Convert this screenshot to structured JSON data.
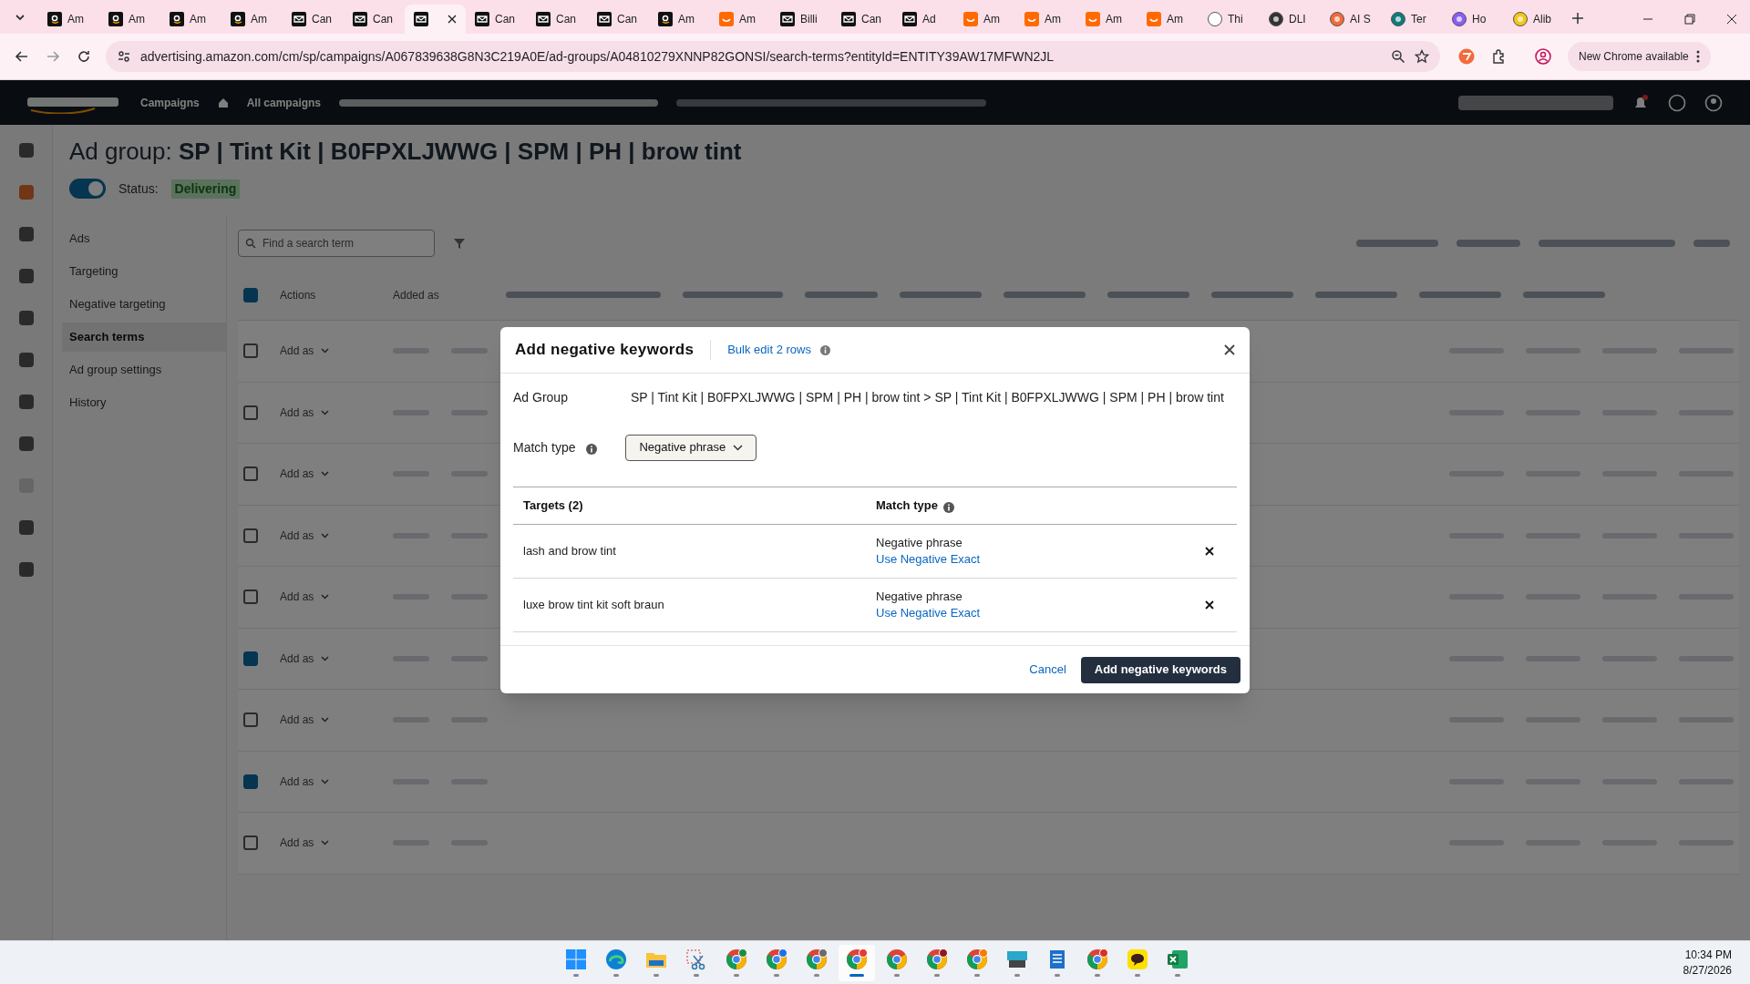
{
  "browser": {
    "tabs": [
      {
        "title": "Am",
        "kind": "amazon",
        "selected": false
      },
      {
        "title": "Am",
        "kind": "amazon",
        "selected": false
      },
      {
        "title": "Am",
        "kind": "amazon",
        "selected": false
      },
      {
        "title": "Am",
        "kind": "amazon",
        "selected": false
      },
      {
        "title": "Can",
        "kind": "mail",
        "selected": false
      },
      {
        "title": "Can",
        "kind": "mail",
        "selected": false
      },
      {
        "kind": "mail",
        "selected": true
      },
      {
        "title": "Can",
        "kind": "mail",
        "selected": false
      },
      {
        "title": "Can",
        "kind": "mail",
        "selected": false
      },
      {
        "title": "Can",
        "kind": "mail",
        "selected": false
      },
      {
        "title": "Am",
        "kind": "amazon",
        "selected": false
      },
      {
        "title": "Am",
        "kind": "orange",
        "selected": false
      },
      {
        "title": "Billi",
        "kind": "mail",
        "selected": false
      },
      {
        "title": "Can",
        "kind": "mail",
        "selected": false
      },
      {
        "title": "Ad",
        "kind": "mail",
        "selected": false
      },
      {
        "title": "Am",
        "kind": "orange",
        "selected": false
      },
      {
        "title": "Am",
        "kind": "orange",
        "selected": false
      },
      {
        "title": "Am",
        "kind": "orange",
        "selected": false
      },
      {
        "title": "Am",
        "kind": "orange",
        "selected": false
      },
      {
        "title": "Thi",
        "kind": "round",
        "color": "#ffffff",
        "selected": false
      },
      {
        "title": "DLI",
        "kind": "round",
        "color": "#333333",
        "selected": false
      },
      {
        "title": "AI S",
        "kind": "round",
        "color": "#f26b3a",
        "selected": false
      },
      {
        "title": "Ter",
        "kind": "round",
        "color": "#117a7a",
        "selected": false
      },
      {
        "title": "Ho",
        "kind": "round",
        "color": "#8b5cf6",
        "selected": false
      },
      {
        "title": "Alib",
        "kind": "round",
        "color": "#f5c518",
        "selected": false
      }
    ],
    "url": "advertising.amazon.com/cm/sp/campaigns/A067839638G8N3C219A0E/ad-groups/A04810279XNNP82GONSI/search-terms?entityId=ENTITY39AW17MFWN2JL",
    "update_button": "New Chrome available"
  },
  "app_header": {
    "breadcrumbs": [
      "Campaigns",
      "All campaigns"
    ]
  },
  "page": {
    "title_prefix": "Ad group:",
    "title": "SP | Tint Kit | B0FPXLJWWG | SPM | PH | brow tint",
    "enabled": true,
    "status_label": "Status:",
    "status": "Delivering"
  },
  "nav": [
    {
      "label": "Ads",
      "selected": false
    },
    {
      "label": "Targeting",
      "selected": false
    },
    {
      "label": "Negative targeting",
      "selected": false
    },
    {
      "label": "Search terms",
      "selected": true
    },
    {
      "label": "Ad group settings",
      "selected": false
    },
    {
      "label": "History",
      "selected": false
    }
  ],
  "search": {
    "placeholder": "Find a search term"
  },
  "table": {
    "columns": [
      "Actions",
      "Added as"
    ],
    "header_checked": true,
    "rows": [
      {
        "action": "Add as",
        "checked": false
      },
      {
        "action": "Add as",
        "checked": false
      },
      {
        "action": "Add as",
        "checked": false
      },
      {
        "action": "Add as",
        "checked": false
      },
      {
        "action": "Add as",
        "checked": false
      },
      {
        "action": "Add as",
        "checked": true
      },
      {
        "action": "Add as",
        "checked": false
      },
      {
        "action": "Add as",
        "checked": true
      },
      {
        "action": "Add as",
        "checked": false
      }
    ]
  },
  "dialog": {
    "title": "Add negative keywords",
    "bulk_link": "Bulk edit 2 rows",
    "ad_group_label": "Ad Group",
    "ad_group": "SP | Tint Kit | B0FPXLJWWG | SPM | PH | brow tint > SP | Tint Kit | B0FPXLJWWG | SPM | PH | brow tint",
    "match_type_label": "Match type",
    "match_type": "Negative phrase",
    "columns": [
      "Targets (2)",
      "Match type"
    ],
    "rows": [
      {
        "target": "lash and brow tint",
        "match": "Negative phrase",
        "link": "Use Negative Exact"
      },
      {
        "target": "luxe brow tint kit soft braun",
        "match": "Negative phrase",
        "link": "Use Negative Exact"
      }
    ],
    "cancel": "Cancel",
    "submit": "Add negative keywords"
  },
  "taskbar": {
    "apps": [
      {
        "kind": "start",
        "selected": false
      },
      {
        "kind": "edge",
        "selected": false
      },
      {
        "kind": "files",
        "selected": false
      },
      {
        "kind": "snip",
        "selected": false
      },
      {
        "kind": "chrome",
        "color": "#1e8e3e",
        "selected": false
      },
      {
        "kind": "chrome",
        "color": "#1a73e8",
        "selected": false
      },
      {
        "kind": "chrome",
        "color": "#6b6b6b",
        "selected": false
      },
      {
        "kind": "chrome",
        "color": "#e53935",
        "selected": true
      },
      {
        "kind": "chrome",
        "selected": false
      },
      {
        "kind": "chrome",
        "color": "#8b1a1a",
        "selected": false
      },
      {
        "kind": "chrome",
        "color": "#f57c00",
        "selected": false
      },
      {
        "kind": "keyboard",
        "selected": false
      },
      {
        "kind": "notepad",
        "selected": false
      },
      {
        "kind": "chrome",
        "color": "#d93025",
        "selected": false
      },
      {
        "kind": "chat",
        "selected": false
      },
      {
        "kind": "excel",
        "selected": false
      }
    ],
    "time": "10:34 PM",
    "date": "8/27/2026"
  }
}
